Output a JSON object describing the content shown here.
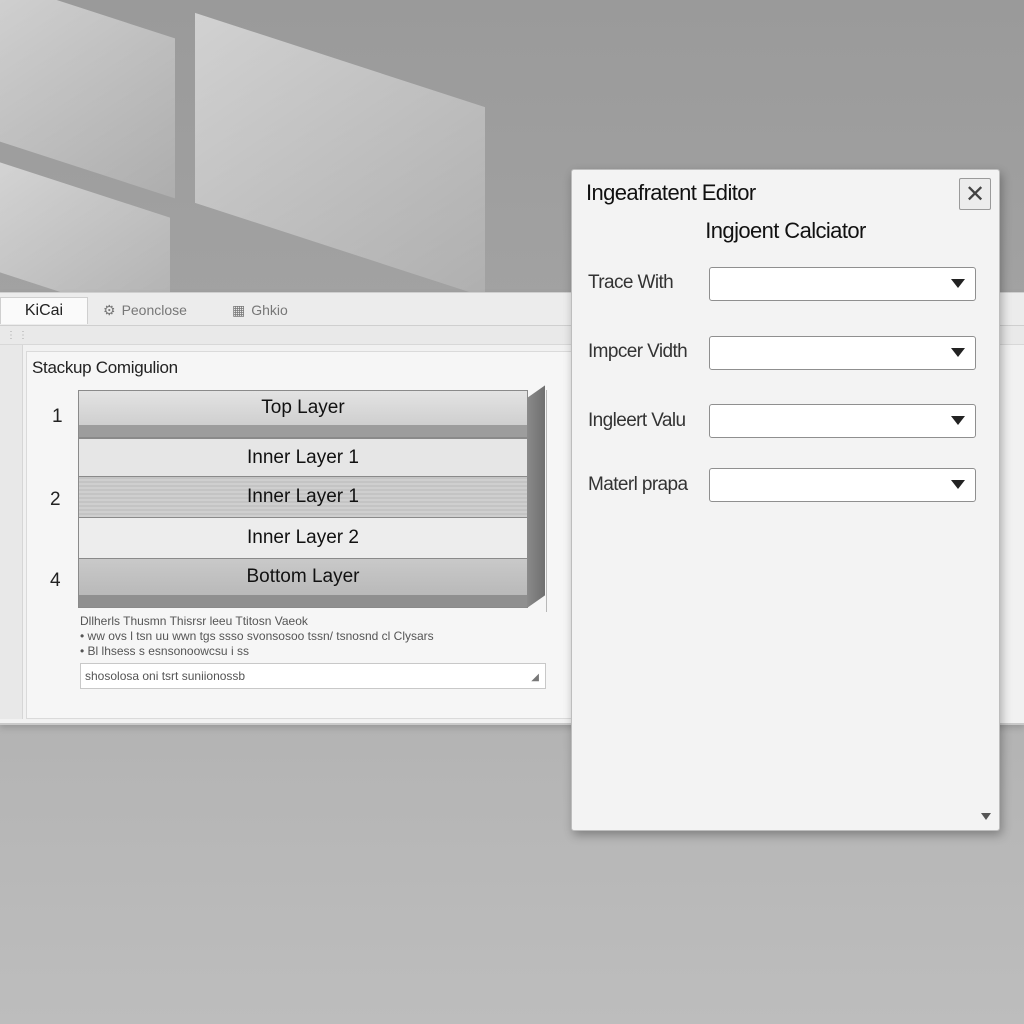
{
  "app": {
    "tabs": [
      {
        "label": "KiCai"
      },
      {
        "label": "Peonclose",
        "icon": "gear-icon"
      },
      {
        "label": "Ghkio",
        "icon": "grid-icon"
      }
    ]
  },
  "stackup": {
    "title": "Stackup Comigulion",
    "layer_numbers": [
      "1",
      "2",
      "4"
    ],
    "layers": [
      {
        "label": "Top Layer"
      },
      {
        "label": "Inner Layer 1"
      },
      {
        "label": "Inner Layer 1"
      },
      {
        "label": "Inner Layer 2"
      },
      {
        "label": "Bottom Layer"
      }
    ],
    "notes": [
      "Dllherls Thusmn Thisrsr leeu Ttitosn Vaeok",
      "• ww ovs  l tsn uu wwn tgs ssso svonsosoo tssn/ tsnosnd cl Clysars",
      "• Bl lhsess s esnsonoowcsu i ss"
    ],
    "notes_field": "shosolosa  oni tsrt  suniionossb"
  },
  "dialog": {
    "title": "Ingeafratent Editor",
    "subtitle": "Ingjoent Calciator",
    "fields": [
      {
        "label": "Trace With",
        "value": ""
      },
      {
        "label": "Impcer Vidth",
        "value": ""
      },
      {
        "label": "Ingleert Valu",
        "value": ""
      },
      {
        "label": "Materl prapa",
        "value": ""
      }
    ],
    "close_symbol": "✕"
  }
}
